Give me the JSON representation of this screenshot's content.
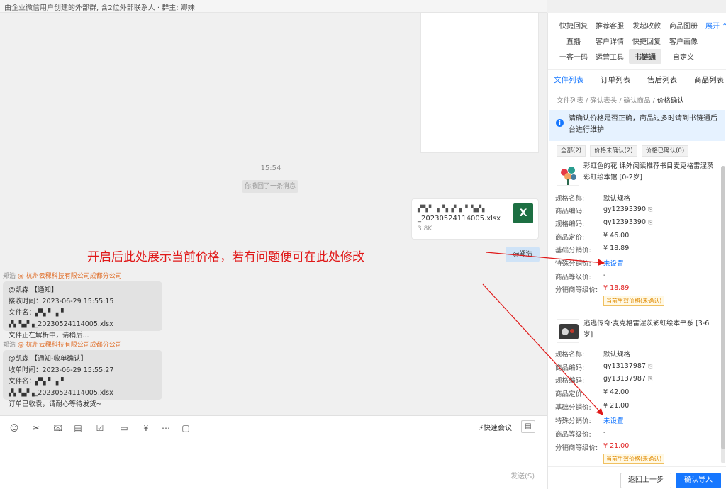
{
  "header": {
    "subtitle": "由企业微信用户创建的外部群, 含2位外部联系人 · 群主: 卿妹"
  },
  "chat": {
    "time": "15:54",
    "recall_note": "你撤回了一条消息",
    "file": {
      "name_blur": "▞▚▘▗▝▖▞▗ ▘▚▞▖",
      "name": "_20230524114005.xlsx",
      "size": "3.8K",
      "icon_letter": "X"
    },
    "sender_tag": "@郑浩",
    "messages": [
      {
        "sender": "郑浩",
        "company": "@ 杭州云稞科技有限公司成都分公司",
        "lines": [
          "@凯森 【通知】",
          "接收时间：2023-06-29 15:55:15",
          "文件名：▞▚ ▘▗▝ ▞▖▚▞▗_20230524114005.xlsx",
          "文件正在解析中，请稍后..."
        ]
      },
      {
        "sender": "郑浩",
        "company": "@ 杭州云稞科技有限公司成都分公司",
        "lines": [
          "@凯森 【通知-收单确认】",
          "收单时间：2023-06-29 15:55:27",
          "文件名：▞▚ ▘▗▝ ▞▖▚▞▗_20230524114005.xlsx",
          "订单已收袁，请耐心等待发货~"
        ]
      }
    ],
    "annotation": "开启后此处展示当前价格，若有问题便可在此处修改"
  },
  "composer": {
    "tools": [
      "☺",
      "✂",
      "🖾",
      "▤",
      "☑",
      "▭",
      "¥",
      "⋯",
      "▢"
    ],
    "quick_meeting": "⚡快速会议",
    "record_icon": "▤",
    "send_hint": "发送(S)"
  },
  "panel": {
    "tools_row1": [
      "快捷回复",
      "推荐客服",
      "发起收款",
      "商品图册"
    ],
    "expand": "展开 ⌃",
    "tools_row2": [
      "直播",
      "客户详情",
      "快捷回复",
      "客户画像"
    ],
    "tools_row3": [
      "一客一码",
      "运营工具",
      "书链通",
      "自定义"
    ],
    "subtabs": [
      "文件列表",
      "订单列表",
      "售后列表",
      "商品列表"
    ],
    "breadcrumb": {
      "path": "文件列表 / 确认表头 / 确认商品 / ",
      "current": "价格确认"
    },
    "notice": "请确认价格是否正确，商品过多时请到书链通后台进行维护",
    "filters": [
      "全部(2)",
      "价格未确认(2)",
      "价格已确认(0)"
    ],
    "field_labels": {
      "spec": "规格名称:",
      "code": "商品编码:",
      "spec_code": "规格编码:",
      "list_price": "商品定价:",
      "base_price": "基础分销价:",
      "special_price": "特殊分销价:",
      "tier_price": "商品等级价:",
      "dist_tier_price": "分销商等级价:"
    },
    "products": [
      {
        "title": "彩虹色的花 课外阅读推荐书目麦克格雷涅茨彩虹绘本馆 [0-2岁]",
        "spec": "默认规格",
        "code": "gy12393390",
        "spec_code": "gy12393390",
        "list_price": "¥ 46.00",
        "base_price": "¥ 18.89",
        "special_price": "未设置",
        "tier_price": "-",
        "dist_tier_price": "¥ 18.89",
        "tag": "当前生效价格(未确认)"
      },
      {
        "title": "逃逃传奇·麦克格雷涅茨彩虹绘本书系 [3-6岁]",
        "spec": "默认规格",
        "code": "gy13137987",
        "spec_code": "gy13137987",
        "list_price": "¥ 42.00",
        "base_price": "¥ 21.00",
        "special_price": "未设置",
        "tier_price": "-",
        "dist_tier_price": "¥ 21.00",
        "tag": "当前生效价格(未确认)"
      }
    ],
    "copy_icon": "⎘",
    "back_button": "返回上一步",
    "confirm_button": "确认导入"
  },
  "colors": {
    "accent": "#1677ff",
    "annotation": "#e01818",
    "excel": "#1d6f42",
    "price_red": "#e02020"
  }
}
